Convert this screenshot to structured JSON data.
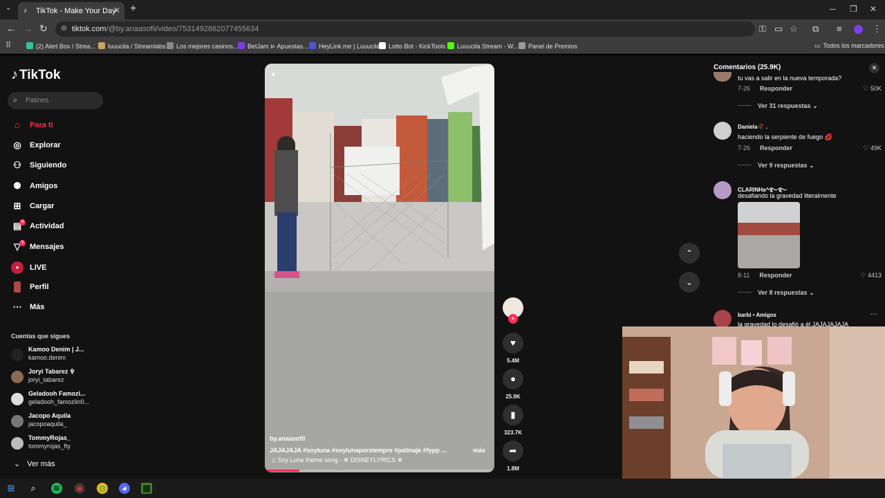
{
  "browser": {
    "tab_title": "TikTok - Make Your Day",
    "url_main": "tiktok.com",
    "url_path": "/@by.anaasofii/video/7531492862077455634",
    "bookmarks": [
      {
        "label": "(2) Alert Box / Strea...",
        "color": "#31c3a2"
      },
      {
        "label": "luuucila / Streamlabs",
        "color": "#c9a36a"
      },
      {
        "label": "Los mejores casinos...",
        "color": "#888888"
      },
      {
        "label": "BetJam ⊳ Apuestas...",
        "color": "#7b3fe4"
      },
      {
        "label": "HeyLink.me | Luuucila",
        "color": "#4a55d6"
      },
      {
        "label": "Lotto Bot - KickTools",
        "color": "#ffffff"
      },
      {
        "label": "Luuucila Stream - W...",
        "color": "#53fc18"
      },
      {
        "label": "Panel de Premios",
        "color": "#9a9a9a"
      }
    ],
    "all_bookmarks": "Todos los marcadores"
  },
  "sidebar": {
    "logo": "TikTok",
    "search_placeholder": "Patines",
    "nav": [
      {
        "label": "Para ti",
        "icon": "home-icon"
      },
      {
        "label": "Explorar",
        "icon": "compass-icon"
      },
      {
        "label": "Siguiendo",
        "icon": "following-icon"
      },
      {
        "label": "Amigos",
        "icon": "friends-icon"
      },
      {
        "label": "Cargar",
        "icon": "upload-icon"
      },
      {
        "label": "Actividad",
        "icon": "activity-icon",
        "badge": "8"
      },
      {
        "label": "Mensajes",
        "icon": "messages-icon",
        "badge": "9"
      },
      {
        "label": "LIVE",
        "icon": "live-icon"
      },
      {
        "label": "Perfil",
        "icon": "profile-icon"
      },
      {
        "label": "Más",
        "icon": "more-icon"
      }
    ],
    "following_title": "Cuentas que sigues",
    "accounts": [
      {
        "name": "Kamoo Denim | J...",
        "handle": "kamoo.denim"
      },
      {
        "name": "Joryi Tabarez ✞",
        "handle": "joryi_tabarez"
      },
      {
        "name": "Geladooh Famozi...",
        "handle": "geladooh_famoziin0..."
      },
      {
        "name": "Jacopo Aquila",
        "handle": "jacopoaquila_"
      },
      {
        "name": "TommyRojas_",
        "handle": "tommyrojas_fty"
      }
    ],
    "see_more": "Ver más"
  },
  "video": {
    "author": "by.anaasofii",
    "caption": "JAJAJAJA #soyluna #soylunaporsiempre #patinaje #fypp ...",
    "more": "más",
    "sound": "♫ Soy Luna theme song - ❄ DISNEYLYRICS ❄",
    "progress": 0.15
  },
  "actions": {
    "likes": "5.4M",
    "comments": "25.9K",
    "saves": "323.7K",
    "shares": "1.8M"
  },
  "comments": {
    "title": "Comentarios (25.9K)",
    "items": [
      {
        "user": "",
        "text": "tu vas a salir en la nueva temporada?",
        "date": "7-26",
        "reply": "Responder",
        "likes": "50K",
        "replies": "Ver 31 respuestas"
      },
      {
        "user": "Daniela🥀 .",
        "text": "haciendo la serpiente de fuego 💋",
        "date": "7-26",
        "reply": "Responder",
        "likes": "49K",
        "replies": "Ver 9 respuestas"
      },
      {
        "user": "CLARINHa^࿐࿐",
        "text": "desafiando la gravedad literalmente",
        "date": "8-11",
        "reply": "Responder",
        "likes": "4413",
        "replies": "Ver 8 respuestas"
      },
      {
        "user": "barbi • Amigos",
        "text": "la gravedad lo desafió a él JAJAJAJAJA",
        "date": "",
        "reply": "",
        "likes": "",
        "replies": ""
      }
    ]
  },
  "colors": {
    "accent": "#fe2c55",
    "background": "#121212"
  }
}
